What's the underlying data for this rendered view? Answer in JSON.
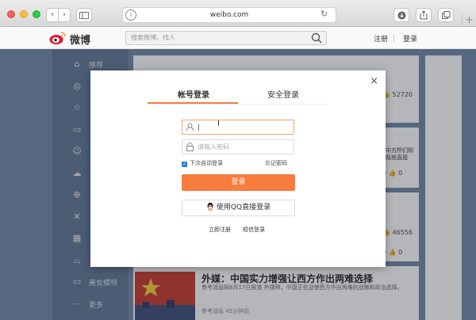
{
  "browser": {
    "url": "weibo.com",
    "back_label": "‹",
    "forward_label": "›",
    "plus_label": "+"
  },
  "header": {
    "brand": "微博",
    "search_placeholder": "搜索微博、找人",
    "register": "注册",
    "login": "登录"
  },
  "sidebar": {
    "items": [
      {
        "label": "推荐",
        "icon": "home-icon",
        "glyph": "⌂"
      },
      {
        "label": "",
        "icon": "medal-icon",
        "glyph": "◎"
      },
      {
        "label": "",
        "icon": "star-icon",
        "glyph": "☆"
      },
      {
        "label": "",
        "icon": "video-icon",
        "glyph": "▭"
      },
      {
        "label": "",
        "icon": "smile-icon",
        "glyph": "☺"
      },
      {
        "label": "",
        "icon": "cloud-icon",
        "glyph": "☁"
      },
      {
        "label": "",
        "icon": "globe-icon",
        "glyph": "⊕"
      },
      {
        "label": "",
        "icon": "tool-icon",
        "glyph": "✕"
      },
      {
        "label": "",
        "icon": "grid-icon",
        "glyph": "▦"
      },
      {
        "label": "",
        "icon": "food-icon",
        "glyph": "⌓"
      },
      {
        "label": "美女模特",
        "icon": "gamepad-icon",
        "glyph": "▭"
      },
      {
        "label": "更多",
        "icon": "more-icon",
        "glyph": "⋯"
      }
    ]
  },
  "feed": {
    "stats": [
      {
        "text": "👍 52720"
      },
      {
        "text": "0 👍 0"
      },
      {
        "text": "👍 46556"
      },
      {
        "text": "0 👍 0"
      }
    ],
    "snippet": "中方所们购既就直接",
    "article": {
      "title": "外媒：中国实力增强让西方作出两难选择",
      "desc": "参考消息网8月17日报道 外媒称，中国正在迫使西方作出两难的战略和政治选择。",
      "meta": "参考消息  42分钟前"
    }
  },
  "modal": {
    "close": "×",
    "tab_account": "帐号登录",
    "tab_secure": "安全登录",
    "username_value": "|",
    "password_placeholder": "请输入密码",
    "remember": "下次自动登录",
    "forgot": "忘记密码",
    "login_button": "登录",
    "qq_button": "使用QQ直接登录",
    "register_link": "立即注册",
    "sms_link": "短信登录"
  },
  "colors": {
    "accent": "#f77c3d",
    "weibo_red": "#e6162d"
  }
}
